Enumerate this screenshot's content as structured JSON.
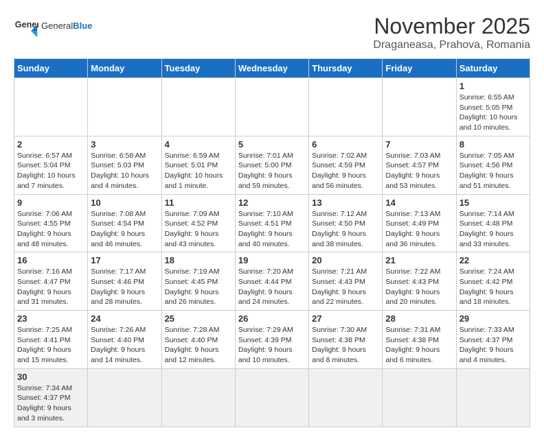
{
  "header": {
    "logo_general": "General",
    "logo_blue": "Blue",
    "month_title": "November 2025",
    "location": "Draganeasa, Prahova, Romania"
  },
  "weekdays": [
    "Sunday",
    "Monday",
    "Tuesday",
    "Wednesday",
    "Thursday",
    "Friday",
    "Saturday"
  ],
  "weeks": [
    [
      {
        "day": "",
        "info": ""
      },
      {
        "day": "",
        "info": ""
      },
      {
        "day": "",
        "info": ""
      },
      {
        "day": "",
        "info": ""
      },
      {
        "day": "",
        "info": ""
      },
      {
        "day": "",
        "info": ""
      },
      {
        "day": "1",
        "info": "Sunrise: 6:55 AM\nSunset: 5:05 PM\nDaylight: 10 hours and 10 minutes."
      }
    ],
    [
      {
        "day": "2",
        "info": "Sunrise: 6:57 AM\nSunset: 5:04 PM\nDaylight: 10 hours and 7 minutes."
      },
      {
        "day": "3",
        "info": "Sunrise: 6:58 AM\nSunset: 5:03 PM\nDaylight: 10 hours and 4 minutes."
      },
      {
        "day": "4",
        "info": "Sunrise: 6:59 AM\nSunset: 5:01 PM\nDaylight: 10 hours and 1 minute."
      },
      {
        "day": "5",
        "info": "Sunrise: 7:01 AM\nSunset: 5:00 PM\nDaylight: 9 hours and 59 minutes."
      },
      {
        "day": "6",
        "info": "Sunrise: 7:02 AM\nSunset: 4:59 PM\nDaylight: 9 hours and 56 minutes."
      },
      {
        "day": "7",
        "info": "Sunrise: 7:03 AM\nSunset: 4:57 PM\nDaylight: 9 hours and 53 minutes."
      },
      {
        "day": "8",
        "info": "Sunrise: 7:05 AM\nSunset: 4:56 PM\nDaylight: 9 hours and 51 minutes."
      }
    ],
    [
      {
        "day": "9",
        "info": "Sunrise: 7:06 AM\nSunset: 4:55 PM\nDaylight: 9 hours and 48 minutes."
      },
      {
        "day": "10",
        "info": "Sunrise: 7:08 AM\nSunset: 4:54 PM\nDaylight: 9 hours and 46 minutes."
      },
      {
        "day": "11",
        "info": "Sunrise: 7:09 AM\nSunset: 4:52 PM\nDaylight: 9 hours and 43 minutes."
      },
      {
        "day": "12",
        "info": "Sunrise: 7:10 AM\nSunset: 4:51 PM\nDaylight: 9 hours and 40 minutes."
      },
      {
        "day": "13",
        "info": "Sunrise: 7:12 AM\nSunset: 4:50 PM\nDaylight: 9 hours and 38 minutes."
      },
      {
        "day": "14",
        "info": "Sunrise: 7:13 AM\nSunset: 4:49 PM\nDaylight: 9 hours and 36 minutes."
      },
      {
        "day": "15",
        "info": "Sunrise: 7:14 AM\nSunset: 4:48 PM\nDaylight: 9 hours and 33 minutes."
      }
    ],
    [
      {
        "day": "16",
        "info": "Sunrise: 7:16 AM\nSunset: 4:47 PM\nDaylight: 9 hours and 31 minutes."
      },
      {
        "day": "17",
        "info": "Sunrise: 7:17 AM\nSunset: 4:46 PM\nDaylight: 9 hours and 28 minutes."
      },
      {
        "day": "18",
        "info": "Sunrise: 7:19 AM\nSunset: 4:45 PM\nDaylight: 9 hours and 26 minutes."
      },
      {
        "day": "19",
        "info": "Sunrise: 7:20 AM\nSunset: 4:44 PM\nDaylight: 9 hours and 24 minutes."
      },
      {
        "day": "20",
        "info": "Sunrise: 7:21 AM\nSunset: 4:43 PM\nDaylight: 9 hours and 22 minutes."
      },
      {
        "day": "21",
        "info": "Sunrise: 7:22 AM\nSunset: 4:43 PM\nDaylight: 9 hours and 20 minutes."
      },
      {
        "day": "22",
        "info": "Sunrise: 7:24 AM\nSunset: 4:42 PM\nDaylight: 9 hours and 18 minutes."
      }
    ],
    [
      {
        "day": "23",
        "info": "Sunrise: 7:25 AM\nSunset: 4:41 PM\nDaylight: 9 hours and 15 minutes."
      },
      {
        "day": "24",
        "info": "Sunrise: 7:26 AM\nSunset: 4:40 PM\nDaylight: 9 hours and 14 minutes."
      },
      {
        "day": "25",
        "info": "Sunrise: 7:28 AM\nSunset: 4:40 PM\nDaylight: 9 hours and 12 minutes."
      },
      {
        "day": "26",
        "info": "Sunrise: 7:29 AM\nSunset: 4:39 PM\nDaylight: 9 hours and 10 minutes."
      },
      {
        "day": "27",
        "info": "Sunrise: 7:30 AM\nSunset: 4:38 PM\nDaylight: 9 hours and 8 minutes."
      },
      {
        "day": "28",
        "info": "Sunrise: 7:31 AM\nSunset: 4:38 PM\nDaylight: 9 hours and 6 minutes."
      },
      {
        "day": "29",
        "info": "Sunrise: 7:33 AM\nSunset: 4:37 PM\nDaylight: 9 hours and 4 minutes."
      }
    ],
    [
      {
        "day": "30",
        "info": "Sunrise: 7:34 AM\nSunset: 4:37 PM\nDaylight: 9 hours and 3 minutes."
      },
      {
        "day": "",
        "info": ""
      },
      {
        "day": "",
        "info": ""
      },
      {
        "day": "",
        "info": ""
      },
      {
        "day": "",
        "info": ""
      },
      {
        "day": "",
        "info": ""
      },
      {
        "day": "",
        "info": ""
      }
    ]
  ]
}
